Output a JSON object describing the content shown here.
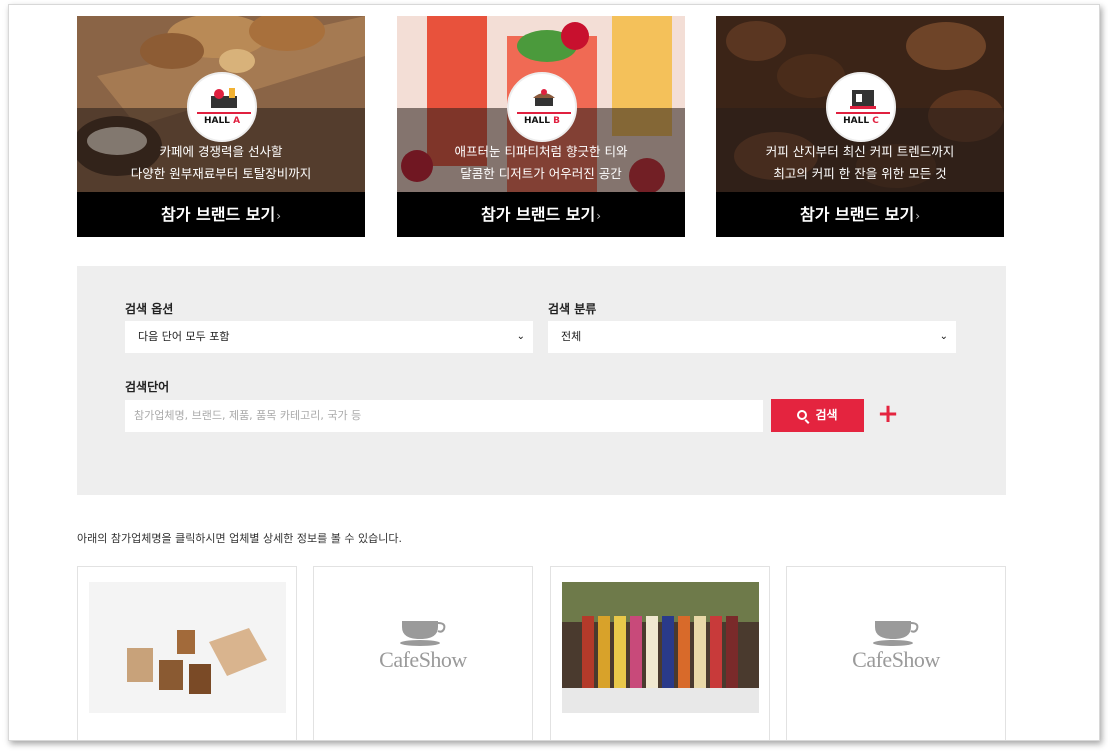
{
  "halls": [
    {
      "badge_hall": "HALL",
      "badge_letter": "A",
      "desc_line1": "카페에 경쟁력을 선사할",
      "desc_line2": "다양한 원부재료부터 토탈장비까지",
      "cta_label": "참가 브랜드 보기",
      "cta_arrow": "›"
    },
    {
      "badge_hall": "HALL",
      "badge_letter": "B",
      "desc_line1": "애프터눈 티파티처럼 향긋한 티와",
      "desc_line2": "달콤한 디저트가 어우러진 공간",
      "cta_label": "참가 브랜드 보기",
      "cta_arrow": "›"
    },
    {
      "badge_hall": "HALL",
      "badge_letter": "C",
      "desc_line1": "커피 산지부터 최신 커피 트렌드까지",
      "desc_line2": "최고의 커피 한 잔을 위한 모든 것",
      "cta_label": "참가 브랜드 보기",
      "cta_arrow": "›"
    }
  ],
  "search": {
    "option_label": "검색 옵션",
    "option_value": "다음 단어 모두 포함",
    "category_label": "검색 분류",
    "category_value": "전체",
    "keyword_label": "검색단어",
    "keyword_placeholder": "참가업체명, 브랜드, 제품, 품목 카테고리, 국가 등",
    "button_label": "검색",
    "plus_label": "+",
    "chevron": "⌄"
  },
  "note": "아래의 참가업체명을 클릭하시면 업체별 상세한 정보를 볼 수 있습니다.",
  "cards": [
    {
      "kind": "photo-jars"
    },
    {
      "kind": "logo",
      "logo_text": "CafeShow"
    },
    {
      "kind": "photo-bottles"
    },
    {
      "kind": "logo",
      "logo_text": "CafeShow"
    }
  ],
  "colors": {
    "accent": "#e4243f",
    "panel_bg": "#eeeeee",
    "cta_bg": "#000000"
  }
}
